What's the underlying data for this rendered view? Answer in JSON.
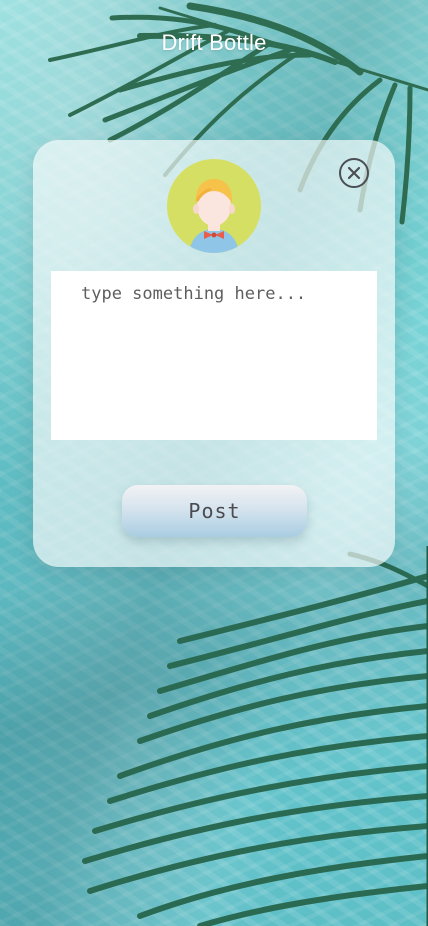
{
  "app": {
    "title": "Drift Bottle"
  },
  "compose": {
    "placeholder": "type something here...",
    "post_label": "Post"
  },
  "colors": {
    "water": "#6fd0d3",
    "card": "#f6fafa",
    "avatar_bg": "#d5df63",
    "post_button_bottom": "#a9cde2"
  },
  "icons": {
    "close": "close-icon",
    "avatar": "avatar-icon"
  }
}
